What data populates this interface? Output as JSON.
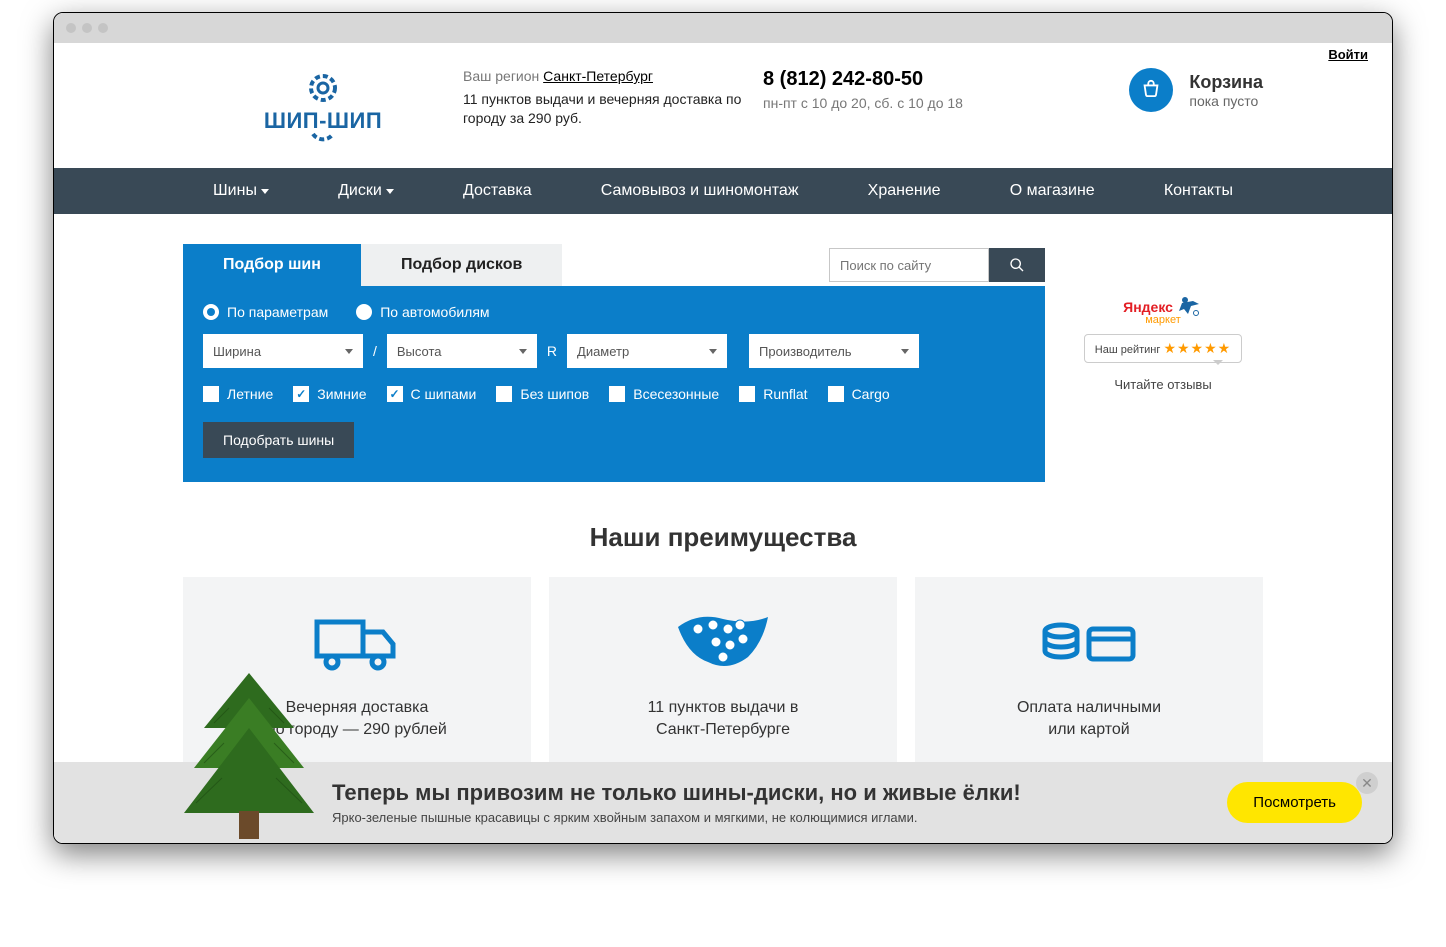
{
  "login_label": "Войти",
  "region": {
    "label": "Ваш регион",
    "city": "Санкт-Петербург",
    "delivery_note": "11 пунктов выдачи и вечерняя доставка по городу за 290 руб."
  },
  "phone": {
    "number": "8 (812) 242-80-50",
    "hours": "пн-пт с 10 до 20, сб. с 10 до 18"
  },
  "cart": {
    "title": "Корзина",
    "status": "пока пусто"
  },
  "logo_text": "ШИП-ШИП",
  "nav": {
    "items": [
      "Шины",
      "Диски",
      "Доставка",
      "Самовывоз и шиномонтаж",
      "Хранение",
      "О магазине",
      "Контакты"
    ]
  },
  "filter": {
    "tab_tires": "Подбор шин",
    "tab_wheels": "Подбор дисков",
    "search_placeholder": "Поиск по сайту",
    "radio_params": "По параметрам",
    "radio_car": "По автомобилям",
    "sel_width": "Ширина",
    "sep1": "/",
    "sel_height": "Высота",
    "sep2": "R",
    "sel_diameter": "Диаметр",
    "sel_maker": "Производитель",
    "chk_summer": "Летние",
    "chk_winter": "Зимние",
    "chk_studs": "С шипами",
    "chk_nostuds": "Без шипов",
    "chk_allseason": "Всесезонные",
    "chk_runflat": "Runflat",
    "chk_cargo": "Cargo",
    "btn_pick": "Подобрать шины"
  },
  "side": {
    "yandex": "Яндекс",
    "market": "маркет",
    "rating_label": "Наш рейтинг",
    "reviews": "Читайте отзывы"
  },
  "advantages": {
    "title": "Наши преимущества",
    "cards": [
      {
        "line1": "Вечерняя доставка",
        "line2": "по городу — 290 рублей"
      },
      {
        "line1": "11 пунктов выдачи в",
        "line2": "Санкт-Петербурге"
      },
      {
        "line1": "Оплата наличными",
        "line2": "или картой"
      }
    ]
  },
  "banner": {
    "title": "Теперь мы привозим не только шины-диски, но и живые ёлки!",
    "sub": "Ярко-зеленые пышные красавицы с ярким хвойным запахом и мягкими, не колющимися иглами.",
    "cta": "Посмотреть"
  }
}
